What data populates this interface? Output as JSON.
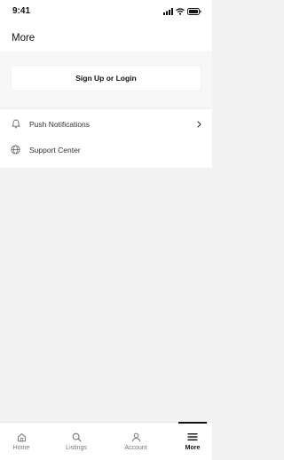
{
  "status_bar": {
    "time": "9:41",
    "icons": [
      "signal-icon",
      "wifi-icon",
      "battery-icon"
    ]
  },
  "header": {
    "title": "More"
  },
  "auth": {
    "button_label": "Sign Up or Login"
  },
  "menu": {
    "items": [
      {
        "label": "Push Notifications",
        "icon": "bell-icon",
        "has_chevron": true
      },
      {
        "label": "Support Center",
        "icon": "globe-icon",
        "has_chevron": false
      }
    ]
  },
  "tab_bar": {
    "active": "More",
    "tabs": [
      {
        "label": "Home",
        "icon": "home-icon"
      },
      {
        "label": "Listings",
        "icon": "search-icon"
      },
      {
        "label": "Account",
        "icon": "user-icon"
      },
      {
        "label": "More",
        "icon": "menu-icon"
      }
    ]
  },
  "colors": {
    "background": "#f2f2f2",
    "surface": "#ffffff",
    "text": "#111111",
    "muted": "#777777"
  }
}
